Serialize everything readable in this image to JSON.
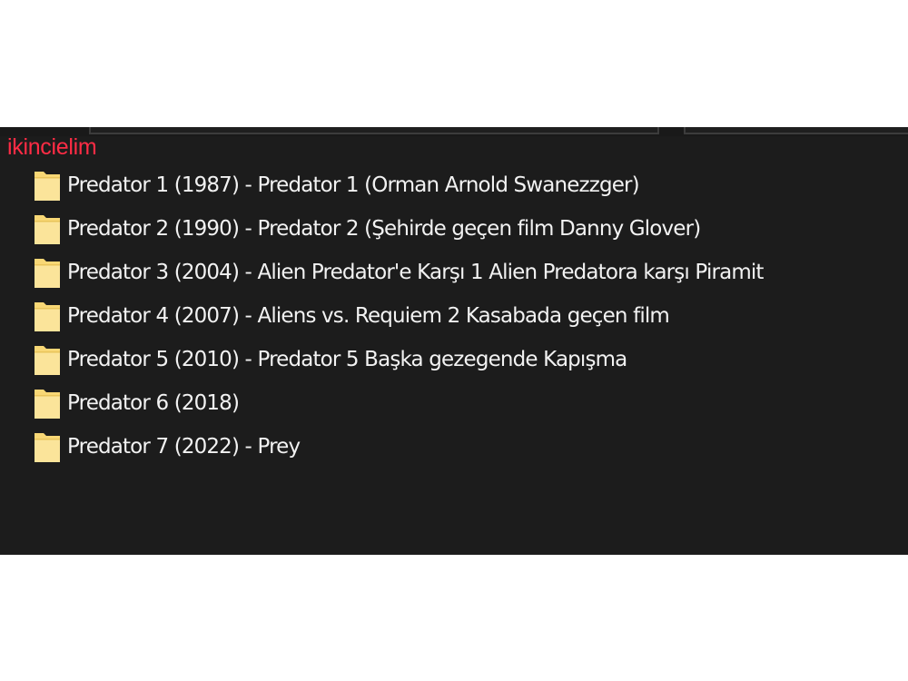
{
  "watermark": "ikincielim",
  "folders": [
    {
      "name": "Predator 1 (1987) - Predator 1 (Orman Arnold Swanezzger)",
      "icon": "folder-icon"
    },
    {
      "name": "Predator 2 (1990) - Predator 2 (Şehirde geçen film  Danny Glover)",
      "icon": "folder-icon"
    },
    {
      "name": "Predator 3 (2004) - Alien Predator'e Karşı 1 Alien Predatora karşı Piramit",
      "icon": "folder-icon"
    },
    {
      "name": "Predator 4 (2007) - Aliens vs. Requiem 2  Kasabada geçen film",
      "icon": "folder-icon"
    },
    {
      "name": "Predator 5 (2010) - Predator 5 Başka gezegende Kapışma",
      "icon": "folder-icon"
    },
    {
      "name": "Predator 6 (2018)",
      "icon": "folder-icon"
    },
    {
      "name": "Predator 7 (2022) - Prey",
      "icon": "folder-icon"
    }
  ],
  "colors": {
    "background": "#1c1c1c",
    "text": "#f2f2f2",
    "folder": "#f8d775",
    "watermark": "#ff2c45"
  }
}
